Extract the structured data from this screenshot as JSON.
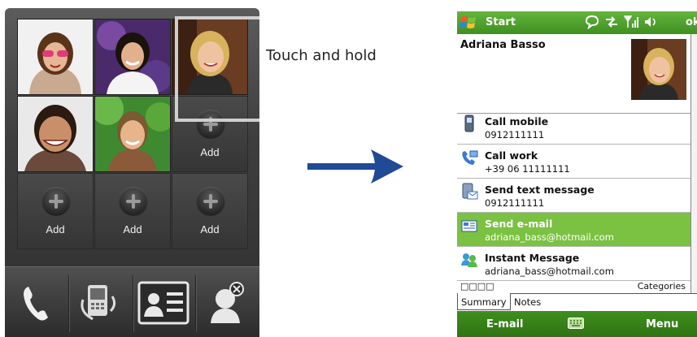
{
  "caption": "Touch and hold",
  "left_phone": {
    "grid": {
      "cells": [
        {
          "type": "photo",
          "name": "contact-photo-1"
        },
        {
          "type": "photo",
          "name": "contact-photo-2"
        },
        {
          "type": "photo",
          "name": "contact-photo-3-adriana"
        },
        {
          "type": "photo",
          "name": "contact-photo-4"
        },
        {
          "type": "photo",
          "name": "contact-photo-5"
        },
        {
          "type": "add",
          "label": "Add"
        },
        {
          "type": "add",
          "label": "Add"
        },
        {
          "type": "add",
          "label": "Add"
        },
        {
          "type": "add",
          "label": "Add"
        }
      ]
    },
    "bottom_bar": {
      "icons": [
        "phone-icon",
        "device-icon",
        "contact-card-icon",
        "remove-contact-icon"
      ]
    }
  },
  "right_phone": {
    "titlebar": {
      "start_label": "Start",
      "ok_label": "ok",
      "status_icons": [
        "message-icon",
        "connectivity-icon",
        "signal-icon",
        "volume-icon"
      ]
    },
    "contact": {
      "name": "Adriana Basso"
    },
    "rows": [
      {
        "label": "Call mobile",
        "value": "0912111111",
        "icon": "mobile-phone-icon"
      },
      {
        "label": "Call work",
        "value": "+39 06 11111111",
        "icon": "work-phone-icon"
      },
      {
        "label": "Send text message",
        "value": "0912111111",
        "icon": "text-message-icon"
      },
      {
        "label": "Send e-mail",
        "value": "adriana_bass@hotmail.com",
        "icon": "email-icon",
        "selected": true
      },
      {
        "label": "Instant Message",
        "value": "adriana_bass@hotmail.com",
        "icon": "instant-message-icon"
      }
    ],
    "tags": {
      "squares": "□□□□",
      "categories": "Categories"
    },
    "tabs": [
      {
        "label": "Summary",
        "active": true
      },
      {
        "label": "Notes",
        "active": false
      }
    ],
    "softkeys": {
      "left": "E-mail",
      "right": "Menu"
    }
  },
  "colors": {
    "wm_green": "#4a9d28",
    "selection_green": "#7bc142",
    "arrow_blue": "#1f4a96"
  }
}
